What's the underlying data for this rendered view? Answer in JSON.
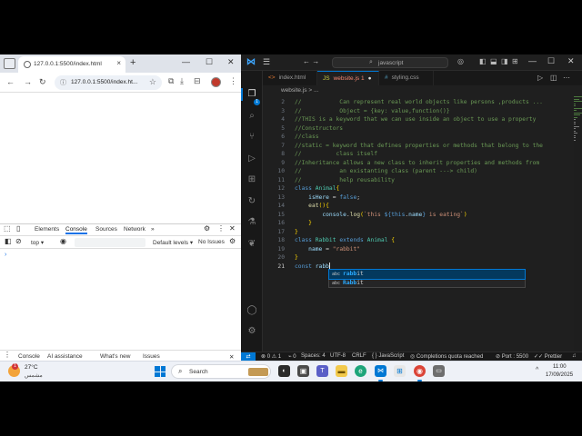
{
  "browser": {
    "tab_title": "127.0.0.1:5500/index.html",
    "url": "127.0.0.1:5500/index.ht...",
    "devtools": {
      "tabs": [
        "Elements",
        "Console",
        "Sources",
        "Network"
      ],
      "active_tab": "Console",
      "context": "top",
      "levels": "Default levels",
      "issues": "No Issues",
      "drawer_tabs": [
        "Console",
        "AI assistance",
        "What's new",
        "Issues"
      ]
    }
  },
  "vscode": {
    "search": "javascript",
    "tabs": [
      {
        "label": "index.html",
        "icon": "html-file-icon"
      },
      {
        "label": "website.js 1",
        "icon": "js-file-icon",
        "modified": true
      },
      {
        "label": "styling.css",
        "icon": "css-file-icon"
      }
    ],
    "breadcrumb": "website.js > ...",
    "activity_badge": "1",
    "code_lines": [
      {
        "n": "2",
        "text": "//           Can represent real world objects like persons ,products ..."
      },
      {
        "n": "3",
        "text": "//           Object = {key: value,function()}"
      },
      {
        "n": "4",
        "text": "//THIS is a keyword that we can use inside an object to use a property"
      },
      {
        "n": "5",
        "text": "//Constructors"
      },
      {
        "n": "6",
        "text": "//class"
      },
      {
        "n": "7",
        "text": "//static = keyword that defines properties or methods that belong to the"
      },
      {
        "n": "8",
        "text": "//          class itself"
      },
      {
        "n": "9",
        "text": "//Inheritance allows a new class to inherit properties and methods from"
      },
      {
        "n": "10",
        "text": "//           an existanting class (parent ---> child)"
      },
      {
        "n": "11",
        "text": "//           help reusability"
      },
      {
        "n": "12",
        "text": "class Animal{"
      },
      {
        "n": "13",
        "text": "    isHere = false;"
      },
      {
        "n": "14",
        "text": "    eat(){"
      },
      {
        "n": "15",
        "text": "        console.log(`this ${this.name} is eating`)"
      },
      {
        "n": "16",
        "text": "    }"
      },
      {
        "n": "17",
        "text": "}"
      },
      {
        "n": "18",
        "text": "class Rabbit extends Animal {"
      },
      {
        "n": "19",
        "text": "    name = \"rabbit\""
      },
      {
        "n": "20",
        "text": "}"
      },
      {
        "n": "21",
        "text": "const rabb"
      }
    ],
    "suggestions": [
      {
        "prefix": "rabb",
        "rest": "it",
        "kind": "abc"
      },
      {
        "prefix": "Rabb",
        "rest": "it",
        "kind": "abc"
      }
    ],
    "status": {
      "errors": "0",
      "warnings": "1",
      "ports": "0",
      "spaces": "Spaces: 4",
      "encoding": "UTF-8",
      "eol": "CRLF",
      "language": "JavaScript",
      "copilot": "Completions quota reached",
      "port": "Port : 5500",
      "formatter": "Prettier"
    }
  },
  "taskbar": {
    "temperature": "27°C",
    "condition": "مشمس",
    "weather_badge": "1",
    "search_placeholder": "Search",
    "time": "11:00",
    "date": "17/09/2025"
  },
  "colors": {
    "accent": "#0078d4",
    "editor_bg": "#1f1f1f",
    "comment": "#6a9955",
    "keyword": "#569cd6",
    "class_name": "#4ec9b0"
  }
}
